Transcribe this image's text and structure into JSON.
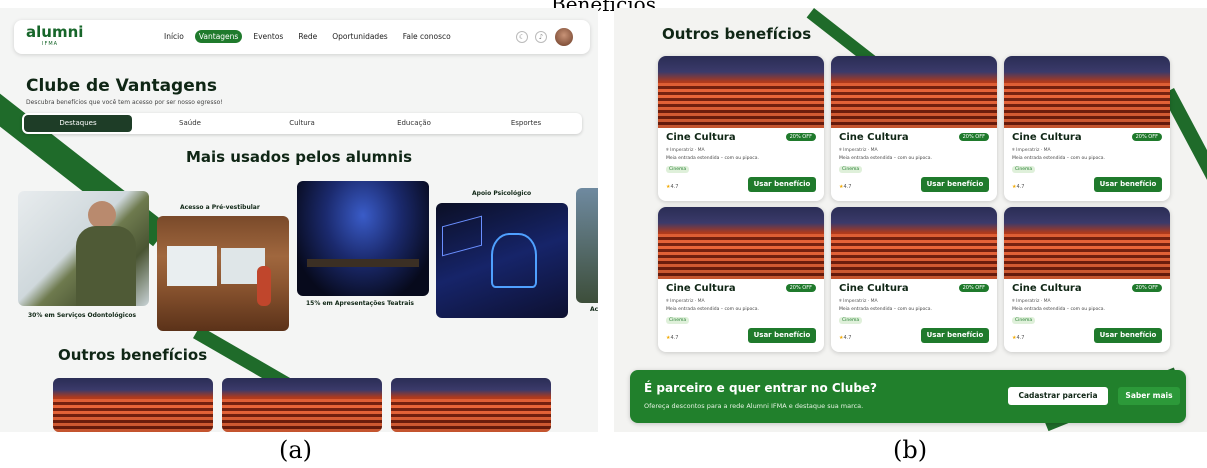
{
  "figure": {
    "title": "Benefícios",
    "caption_a": "(a)",
    "caption_b": "(b)"
  },
  "panel_a": {
    "logo": "alumni",
    "logo_sub": "IFMA",
    "nav": [
      "Início",
      "Vantagens",
      "Eventos",
      "Rede",
      "Oportunidades",
      "Fale conosco"
    ],
    "nav_active": "Vantagens",
    "page_title": "Clube de Vantagens",
    "page_subtitle": "Descubra benefícios que você tem acesso por ser nosso egresso!",
    "tabs": [
      "Destaques",
      "Saúde",
      "Cultura",
      "Educação",
      "Esportes"
    ],
    "most_used_title": "Mais usados pelos alumnis",
    "cards": [
      {
        "label": "30% em Serviços Odontológicos"
      },
      {
        "label": "Acesso a Pré-vestibular"
      },
      {
        "label": "15% em Apresentações Teatrais"
      },
      {
        "label": "Apoio Psicológico"
      },
      {
        "label": "Ac"
      }
    ],
    "others_title": "Outros benefícios",
    "colors": {
      "brand": "#1f7a2c",
      "dark": "#0f2615"
    }
  },
  "panel_b": {
    "others_title": "Outros benefícios",
    "cards": [
      {
        "name": "Cine Cultura",
        "badge": "20% OFF",
        "location": "Imperatriz · MA",
        "desc": "Meia entrada estendida – com ou pipoca.",
        "tag": "Cinema",
        "rating": "4.7",
        "button": "Usar benefício"
      },
      {
        "name": "Cine Cultura",
        "badge": "20% OFF",
        "location": "Imperatriz · MA",
        "desc": "Meia entrada estendida – com ou pipoca.",
        "tag": "Cinema",
        "rating": "4.7",
        "button": "Usar benefício"
      },
      {
        "name": "Cine Cultura",
        "badge": "20% OFF",
        "location": "Imperatriz · MA",
        "desc": "Meia entrada estendida – com ou pipoca.",
        "tag": "Cinema",
        "rating": "4.7",
        "button": "Usar benefício"
      },
      {
        "name": "Cine Cultura",
        "badge": "20% OFF",
        "location": "Imperatriz · MA",
        "desc": "Meia entrada estendida – com ou pipoca.",
        "tag": "Cinema",
        "rating": "4.7",
        "button": "Usar benefício"
      },
      {
        "name": "Cine Cultura",
        "badge": "20% OFF",
        "location": "Imperatriz · MA",
        "desc": "Meia entrada estendida – com ou pipoca.",
        "tag": "Cinema",
        "rating": "4.7",
        "button": "Usar benefício"
      },
      {
        "name": "Cine Cultura",
        "badge": "20% OFF",
        "location": "Imperatriz · MA",
        "desc": "Meia entrada estendida – com ou pipoca.",
        "tag": "Cinema",
        "rating": "4.7",
        "button": "Usar benefício"
      }
    ],
    "banner": {
      "title": "É parceiro e quer entrar no Clube?",
      "subtitle": "Ofereça descontos para a rede Alumni IFMA e destaque sua marca.",
      "primary_button": "Cadastrar parceria",
      "secondary_button": "Saber mais"
    }
  }
}
